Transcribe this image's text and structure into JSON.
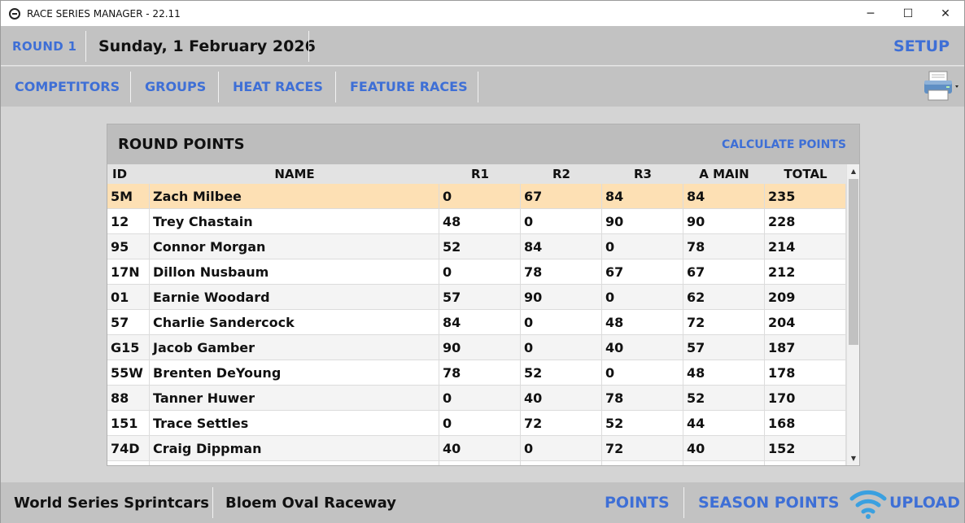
{
  "window": {
    "title": "RACE SERIES MANAGER - 22.11",
    "controls": {
      "minimize": "─",
      "maximize": "☐",
      "close": "✕"
    }
  },
  "header": {
    "round_label": "ROUND 1",
    "date": "Sunday, 1 February 2026",
    "setup_label": "SETUP"
  },
  "nav": {
    "items": [
      {
        "label": "COMPETITORS"
      },
      {
        "label": "GROUPS"
      },
      {
        "label": "HEAT RACES"
      },
      {
        "label": "FEATURE RACES"
      }
    ],
    "print_icon": "printer-icon"
  },
  "panel": {
    "title": "ROUND POINTS",
    "calculate_label": "CALCULATE POINTS",
    "columns": [
      "ID",
      "NAME",
      "R1",
      "R2",
      "R3",
      "A MAIN",
      "TOTAL"
    ],
    "rows": [
      {
        "id": "5M",
        "name": "Zach Milbee",
        "r1": "0",
        "r2": "67",
        "r3": "84",
        "amain": "84",
        "total": "235",
        "selected": true
      },
      {
        "id": "12",
        "name": "Trey Chastain",
        "r1": "48",
        "r2": "0",
        "r3": "90",
        "amain": "90",
        "total": "228"
      },
      {
        "id": "95",
        "name": "Connor Morgan",
        "r1": "52",
        "r2": "84",
        "r3": "0",
        "amain": "78",
        "total": "214"
      },
      {
        "id": "17N",
        "name": "Dillon Nusbaum",
        "r1": "0",
        "r2": "78",
        "r3": "67",
        "amain": "67",
        "total": "212"
      },
      {
        "id": "01",
        "name": "Earnie Woodard",
        "r1": "57",
        "r2": "90",
        "r3": "0",
        "amain": "62",
        "total": "209"
      },
      {
        "id": "57",
        "name": "Charlie Sandercock",
        "r1": "84",
        "r2": "0",
        "r3": "48",
        "amain": "72",
        "total": "204"
      },
      {
        "id": "G15",
        "name": "Jacob Gamber",
        "r1": "90",
        "r2": "0",
        "r3": "40",
        "amain": "57",
        "total": "187"
      },
      {
        "id": "55W",
        "name": "Brenten DeYoung",
        "r1": "78",
        "r2": "52",
        "r3": "0",
        "amain": "48",
        "total": "178"
      },
      {
        "id": "88",
        "name": "Tanner Huwer",
        "r1": "0",
        "r2": "40",
        "r3": "78",
        "amain": "52",
        "total": "170"
      },
      {
        "id": "151",
        "name": "Trace Settles",
        "r1": "0",
        "r2": "72",
        "r3": "52",
        "amain": "44",
        "total": "168"
      },
      {
        "id": "74D",
        "name": "Craig Dippman",
        "r1": "40",
        "r2": "0",
        "r3": "72",
        "amain": "40",
        "total": "152"
      },
      {
        "id": "",
        "name": "",
        "r1": "",
        "r2": "",
        "r3": "",
        "amain": "",
        "total": ""
      }
    ]
  },
  "footer": {
    "series": "World Series Sprintcars",
    "track": "Bloem Oval Raceway",
    "points_label": "POINTS",
    "season_points_label": "SEASON POINTS",
    "upload_label": "UPLOAD",
    "upload_icon": "wifi-icon"
  },
  "colors": {
    "accent": "#3e6fd6",
    "selected_row": "#fde0b4",
    "band": "#c2c2c2"
  }
}
